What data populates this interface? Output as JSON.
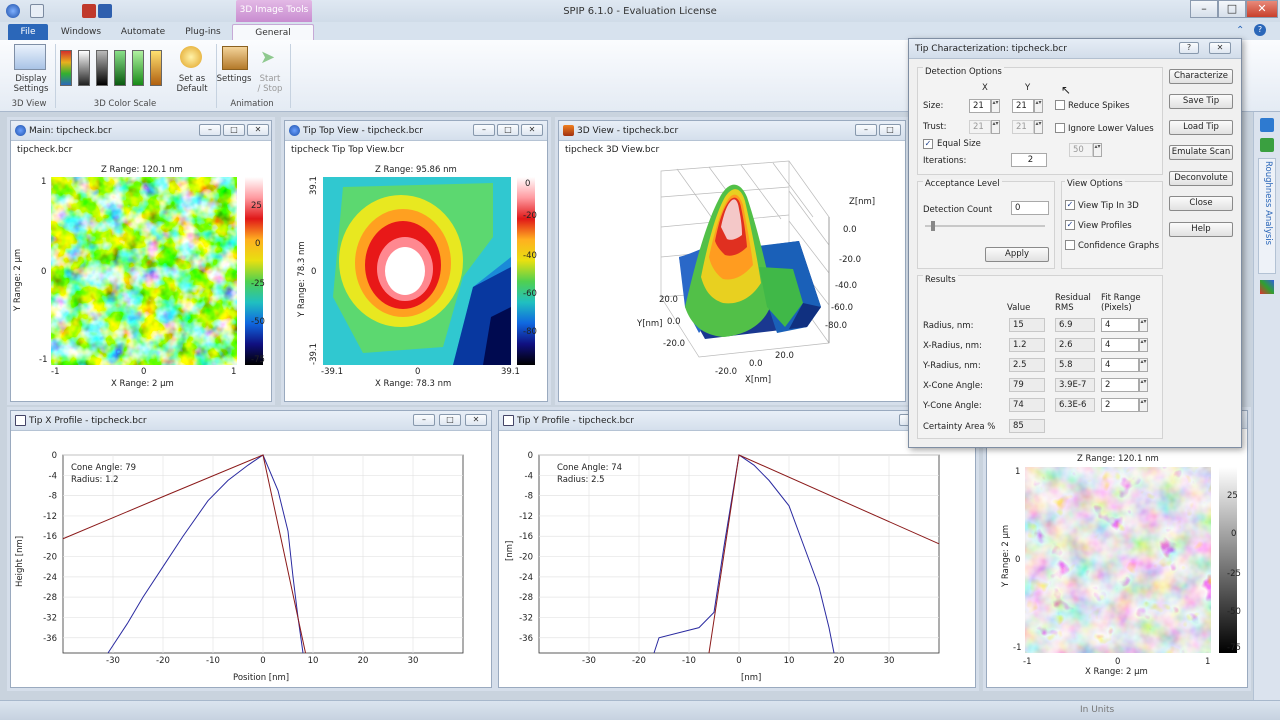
{
  "app": {
    "title": "SPIP 6.1.0 - Evaluation License",
    "contextual_tab": "3D Image Tools"
  },
  "ribbon": {
    "tabs": [
      "File",
      "Windows",
      "Automate",
      "Plug-ins",
      "General"
    ],
    "display_settings": "Display\nSettings",
    "set_as_default": "Set as\nDefault",
    "settings": "Settings",
    "start_stop": "Start\n/ Stop",
    "groups": [
      "3D View",
      "3D Color Scale",
      "Animation"
    ],
    "swatch_colors": [
      "#d4302b",
      "#a0a0a0",
      "#2a2a2a",
      "#1f8a2a",
      "#32b030",
      "#e8b01e"
    ]
  },
  "windows": {
    "main": {
      "title": "Main: tipcheck.bcr",
      "file": "tipcheck.bcr",
      "z_range": "Z Range:  120.1 nm",
      "y_range": "Y Range: 2 µm",
      "x_range": "X Range: 2 µm",
      "xticks": [
        "-1",
        "0",
        "1"
      ],
      "yticks": [
        "1",
        "0",
        "-1"
      ],
      "cticks": [
        "25",
        "0",
        "-25",
        "-50",
        "-75"
      ]
    },
    "top": {
      "title": "Tip Top View - tipcheck.bcr",
      "file": "tipcheck Tip Top View.bcr",
      "z_range": "Z Range:  95.86 nm",
      "y_range": "Y Range:  78.3 nm",
      "x_range": "X Range:  78.3 nm",
      "xticks": [
        "-39.1",
        "0",
        "39.1"
      ],
      "yticks": [
        "39.1",
        "0",
        "-39.1"
      ],
      "cticks": [
        "0",
        "-20",
        "-40",
        "-60",
        "-80"
      ]
    },
    "view3d": {
      "title": "3D View - tipcheck.bcr",
      "file": "tipcheck 3D View.bcr",
      "z_label": "Z[nm]",
      "y_label": "Y[nm]",
      "x_label": "X[nm]",
      "zticks": [
        "0.0",
        "-20.0",
        "-40.0",
        "-60.0",
        "-80.0"
      ],
      "yticks": [
        "20.0",
        "0.0",
        "-20.0"
      ],
      "xticks": [
        "-20.0",
        "0.0",
        "20.0"
      ]
    },
    "xprofile": {
      "title": "Tip X Profile - tipcheck.bcr",
      "cone_angle": "Cone Angle:  79",
      "radius": "Radius:  1.2",
      "ylabel": "Height [nm]",
      "xlabel": "Position [nm]"
    },
    "yprofile": {
      "title": "Tip Y Profile - tipcheck.bcr",
      "cone_angle": "Cone Angle:  74",
      "radius": "Radius:  2.5",
      "ylabel": "[nm]",
      "xlabel": "[nm]"
    },
    "bw": {
      "z_range": "Z Range:  120.1 nm",
      "y_range": "Y Range: 2 µm",
      "x_range": "X Range: 2 µm",
      "xticks": [
        "-1",
        "0",
        "1"
      ],
      "yticks": [
        "1",
        "0",
        "-1"
      ],
      "cticks": [
        "25",
        "0",
        "-25",
        "-50",
        "-75"
      ]
    }
  },
  "chart_data": [
    {
      "type": "line",
      "title": "",
      "xlabel": "Position [nm]",
      "ylabel": "Height [nm]",
      "xlim": [
        -40,
        40
      ],
      "ylim": [
        -39,
        0
      ],
      "xticks": [
        -30,
        -20,
        -10,
        0,
        10,
        20,
        30
      ],
      "yticks": [
        0,
        -4,
        -8,
        -12,
        -16,
        -20,
        -24,
        -28,
        -32,
        -36
      ],
      "series": [
        {
          "color": "#2a2aa0",
          "x": [
            -31,
            -27,
            -24,
            -20,
            -16,
            -11,
            -7,
            -3,
            0,
            3,
            5,
            6,
            7,
            8
          ],
          "y": [
            -39,
            -33,
            -28,
            -22,
            -16,
            -9,
            -5,
            -2,
            0,
            -7,
            -15,
            -24,
            -32,
            -39
          ]
        },
        {
          "color": "#8b1a1a",
          "x": [
            -40,
            -20,
            0,
            4,
            8.5
          ],
          "y": [
            -16.5,
            -8.2,
            0,
            -18.3,
            -39
          ]
        }
      ]
    },
    {
      "type": "line",
      "title": "",
      "xlabel": "[nm]",
      "ylabel": "[nm]",
      "xlim": [
        -40,
        40
      ],
      "ylim": [
        -39,
        0
      ],
      "xticks": [
        -30,
        -20,
        -10,
        0,
        10,
        20,
        30
      ],
      "yticks": [
        0,
        -4,
        -8,
        -12,
        -16,
        -20,
        -24,
        -28,
        -32,
        -36
      ],
      "series": [
        {
          "color": "#2a2aa0",
          "x": [
            -17,
            -16,
            -8,
            -5,
            -3,
            0,
            3,
            6,
            10,
            13,
            16,
            18,
            19
          ],
          "y": [
            -39,
            -36,
            -34,
            -31,
            -18,
            0,
            -2,
            -5,
            -10,
            -18,
            -26,
            -34,
            -39
          ]
        },
        {
          "color": "#8b1a1a",
          "x": [
            -6,
            0,
            40
          ],
          "y": [
            -39,
            0,
            -17.5
          ]
        }
      ]
    }
  ],
  "dialog": {
    "title": "Tip Characterization: tipcheck.bcr",
    "detection_options": "Detection Options",
    "x": "X",
    "y": "Y",
    "size_label": "Size:",
    "size_x": "21",
    "size_y": "21",
    "trust_label": "Trust:",
    "trust_x": "21",
    "trust_y": "21",
    "equal_size": "Equal Size",
    "iterations_label": "Iterations:",
    "iterations": "2",
    "reduce_spikes": "Reduce Spikes",
    "ignore_lower": "Ignore Lower Values",
    "ignore_value": "50",
    "acceptance_level": "Acceptance Level",
    "detection_count_label": "Detection Count",
    "detection_count": "0",
    "apply": "Apply",
    "view_options": "View Options",
    "view_tip_3d": "View Tip In 3D",
    "view_profiles": "View Profiles",
    "confidence_graphs": "Confidence Graphs",
    "results": "Results",
    "col_value": "Value",
    "col_residual": "Residual\nRMS",
    "col_fit": "Fit Range\n(Pixels)",
    "rows": [
      {
        "label": "Radius, nm:",
        "value": "15",
        "rms": "6.9",
        "fit": "4"
      },
      {
        "label": "X-Radius, nm:",
        "value": "1.2",
        "rms": "2.6",
        "fit": "4"
      },
      {
        "label": "Y-Radius, nm:",
        "value": "2.5",
        "rms": "5.8",
        "fit": "4"
      },
      {
        "label": "X-Cone Angle:",
        "value": "79",
        "rms": "3.9E-7",
        "fit": "2"
      },
      {
        "label": "Y-Cone Angle:",
        "value": "74",
        "rms": "6.3E-6",
        "fit": "2"
      }
    ],
    "certainty_label": "Certainty Area %",
    "certainty": "85",
    "buttons": [
      "Characterize",
      "Save Tip",
      "Load Tip",
      "Emulate Scan",
      "Deconvolute",
      "Close",
      "Help"
    ]
  },
  "side_panel": "Roughness Analysis",
  "status": "In Units"
}
